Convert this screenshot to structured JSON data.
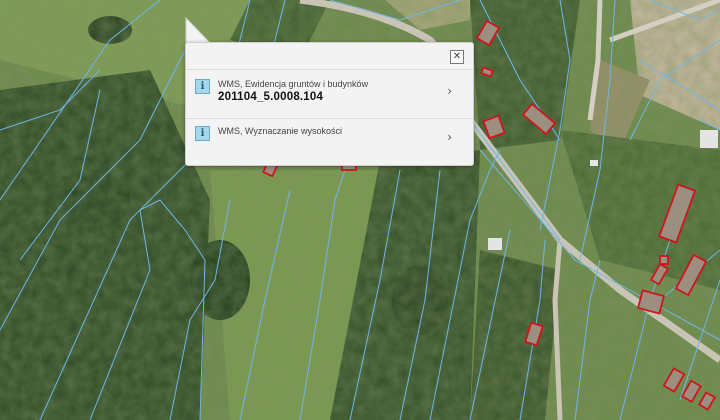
{
  "popup": {
    "close_icon": "close-icon",
    "items": [
      {
        "icon": "info-icon",
        "icon_glyph": "i",
        "layer": "WMS, Ewidencja gruntów i budynków",
        "value": "201104_5.0008.104",
        "chevron": "›"
      },
      {
        "icon": "info-icon",
        "icon_glyph": "i",
        "layer": "WMS, Wyznaczanie wysokości",
        "chevron": "›"
      }
    ]
  },
  "colors": {
    "parcel_boundary": "#6fb7e8",
    "building_outline": "#d0141c",
    "popup_background": "#f3f3f3"
  }
}
